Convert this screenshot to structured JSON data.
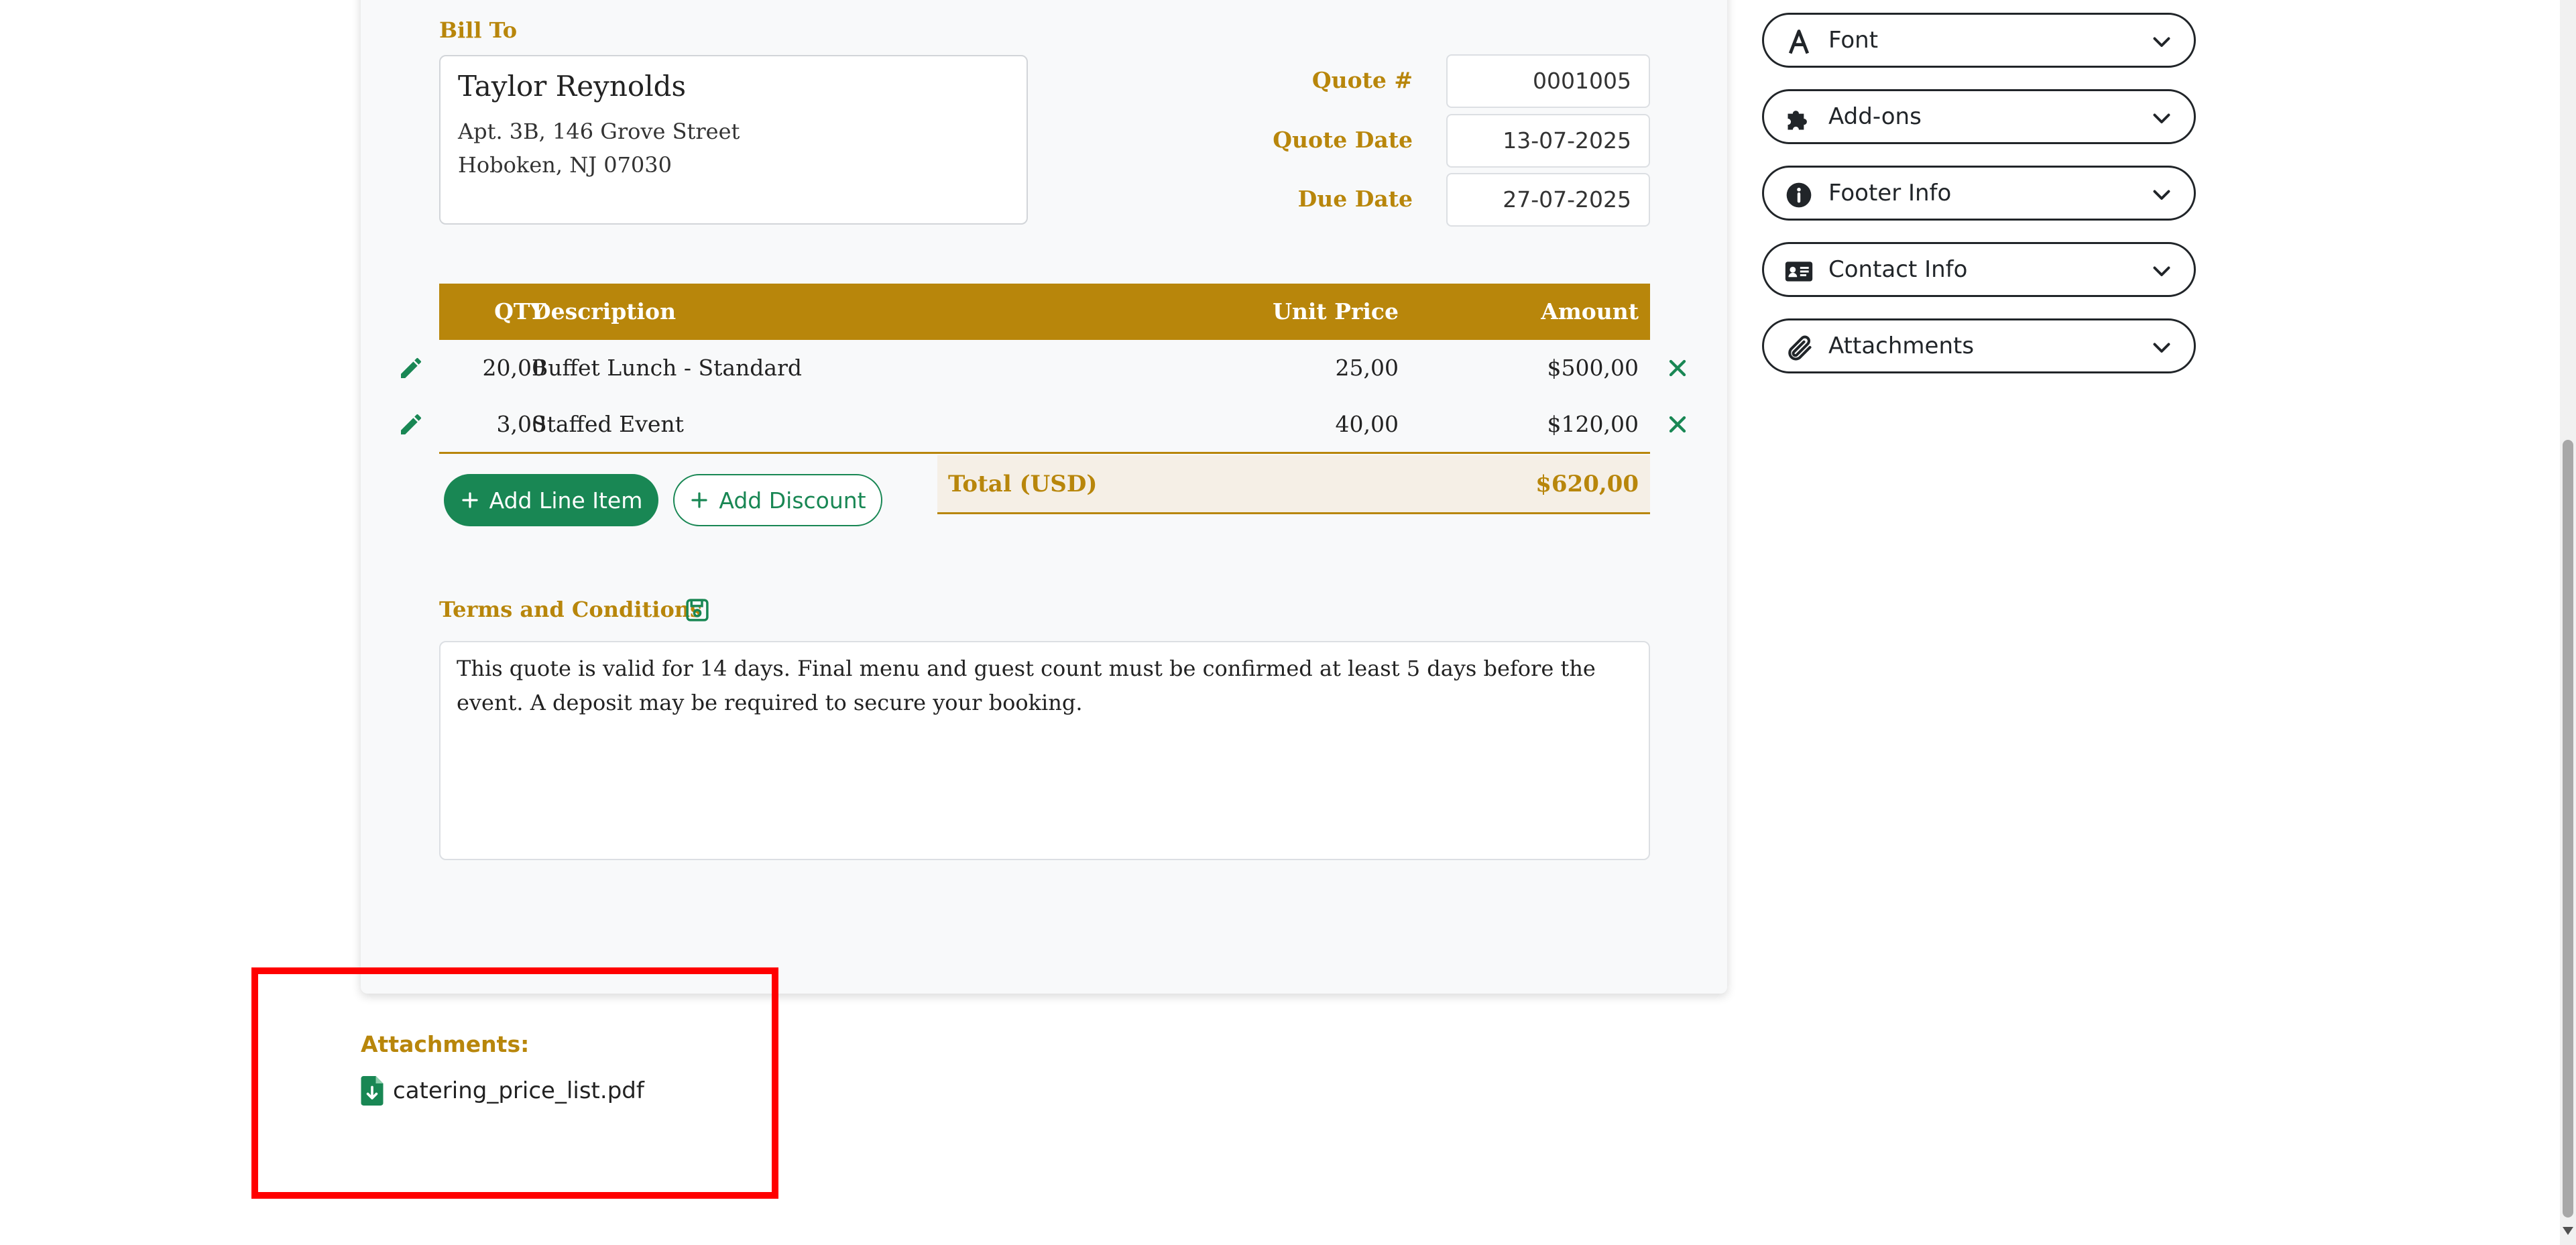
{
  "bill_to": {
    "label": "Bill To",
    "name": "Taylor Reynolds",
    "address_line1": "Apt. 3B, 146 Grove Street",
    "address_line2": "Hoboken, NJ 07030"
  },
  "meta": {
    "quote_number_label": "Quote #",
    "quote_number": "0001005",
    "quote_date_label": "Quote Date",
    "quote_date": "13-07-2025",
    "due_date_label": "Due Date",
    "due_date": "27-07-2025"
  },
  "table": {
    "headers": {
      "qty": "QTY",
      "description": "Description",
      "unit_price": "Unit Price",
      "amount": "Amount"
    },
    "rows": [
      {
        "qty": "20,00",
        "description": "Buffet Lunch - Standard",
        "unit_price": "25,00",
        "amount": "$500,00"
      },
      {
        "qty": "3,00",
        "description": "Staffed Event",
        "unit_price": "40,00",
        "amount": "$120,00"
      }
    ],
    "add_line_item_label": "Add Line Item",
    "add_discount_label": "Add Discount",
    "total_label": "Total (USD)",
    "total_value": "$620,00"
  },
  "terms": {
    "label": "Terms and Conditions",
    "text": "This quote is valid for 14 days. Final menu and guest count must be confirmed at least 5 days before the event. A deposit may be required to secure your booking."
  },
  "attachments": {
    "title": "Attachments:",
    "files": [
      "catering_price_list.pdf"
    ]
  },
  "sidebar": {
    "items": [
      {
        "label": "Font",
        "icon": "font-icon"
      },
      {
        "label": "Add-ons",
        "icon": "puzzle-icon"
      },
      {
        "label": "Footer Info",
        "icon": "info-icon"
      },
      {
        "label": "Contact Info",
        "icon": "contact-card-icon"
      },
      {
        "label": "Attachments",
        "icon": "paperclip-icon"
      }
    ]
  },
  "colors": {
    "accent_gold": "#b8860b",
    "success_green": "#198754",
    "highlight_red": "#ff0000"
  }
}
